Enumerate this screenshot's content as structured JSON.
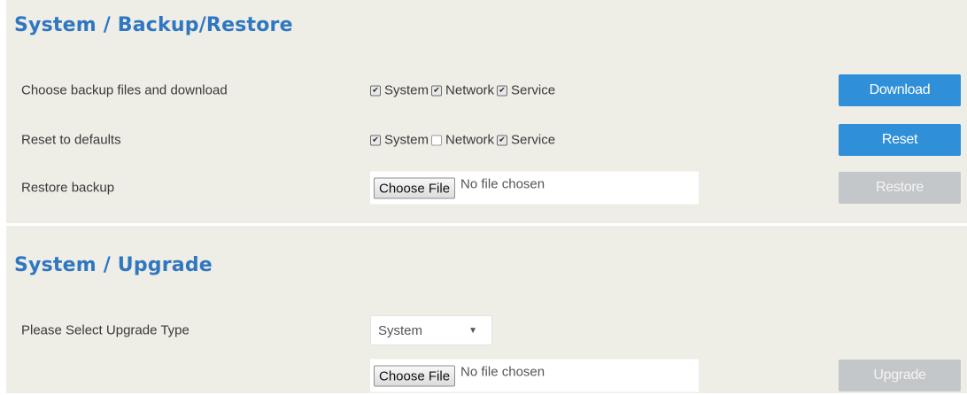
{
  "backup_section": {
    "title": "System / Backup/Restore",
    "rows": [
      {
        "label": "Choose backup files and download",
        "options": [
          {
            "label": "System",
            "checked": true
          },
          {
            "label": "Network",
            "checked": true
          },
          {
            "label": "Service",
            "checked": true
          }
        ],
        "button": "Download"
      },
      {
        "label": "Reset to defaults",
        "options": [
          {
            "label": "System",
            "checked": true
          },
          {
            "label": "Network",
            "checked": false
          },
          {
            "label": "Service",
            "checked": true
          }
        ],
        "button": "Reset"
      },
      {
        "label": "Restore backup",
        "file_button": "Choose File",
        "file_status": "No file chosen",
        "button": "Restore"
      }
    ]
  },
  "upgrade_section": {
    "title": "System / Upgrade",
    "type_label": "Please Select Upgrade Type",
    "type_selected": "System",
    "file_button": "Choose File",
    "file_status": "No file chosen",
    "button": "Upgrade"
  },
  "colors": {
    "title": "#2f77c0",
    "primary_button": "#2f8fd8",
    "disabled_button": "#c4c7ca",
    "panel_background": "#eeede6"
  },
  "icons": {
    "checkbox_tick": "check-icon",
    "select_caret": "chevron-down-icon"
  }
}
